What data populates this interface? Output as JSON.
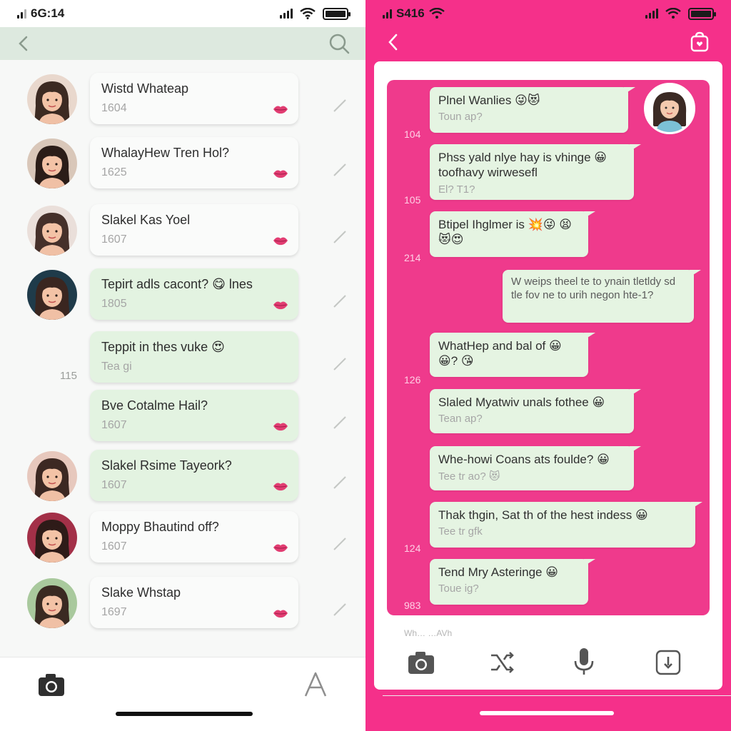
{
  "left_phone": {
    "status": {
      "time": "6G:14"
    },
    "chats": [
      {
        "name": "Wistd Whateap",
        "sub": "1604",
        "style": "white"
      },
      {
        "name": "WhalayHew Tren Hol?",
        "sub": "1625",
        "style": "white"
      },
      {
        "name": "Slakel Kas Yoel",
        "sub": "1607",
        "style": "white"
      },
      {
        "name": "Tepirt adls cacont? 😋 lnes",
        "sub": "1805",
        "style": "green"
      },
      {
        "name": "Teppit in thes vuke 😍",
        "sub": "Tea gi",
        "style": "green",
        "side_number": "115"
      },
      {
        "name": "Bve Cotalme Hail?",
        "sub": "1607",
        "style": "green"
      },
      {
        "name": "Slakel Rsime Tayeork?",
        "sub": "1607",
        "style": "green"
      },
      {
        "name": "Moppy Bhautind off?",
        "sub": "1607",
        "style": "white"
      },
      {
        "name": "Slake Whstap",
        "sub": "1697",
        "style": "white"
      }
    ]
  },
  "right_phone": {
    "status": {
      "time": "S416"
    },
    "messages": [
      {
        "text": "Plnel Wanlies 😜😻",
        "sub": "Toun ap?",
        "side": "104"
      },
      {
        "text": "Phss yald nlye hay is vhinge 😀 toofhavy wirwesefl",
        "sub": "El? T1?",
        "side": "105"
      },
      {
        "text": "Btipel Ihglmer is 💥😜 😫😻😍",
        "sub": "",
        "side": "214"
      },
      {
        "text": "W weips theel te to ynain tletldy sd tle fov ne to urih negon hte-1?",
        "sub": "",
        "side": ""
      },
      {
        "text": "WhatHep and bal of 😀 😀? 😘",
        "sub": "",
        "side": "126"
      },
      {
        "text": "Slaled Myatwiv unals fothee 😀",
        "sub": "Tean ap?",
        "side": ""
      },
      {
        "text": "Whe-howi Coans ats foulde? 😀",
        "sub": "Tee tr ao? 😻",
        "side": ""
      },
      {
        "text": "Thak thgin, Sat th of the hest indess 😀",
        "sub": "Tee tr gfk",
        "side": "124"
      },
      {
        "text": "Tend Mry Asteringe 😀",
        "sub": "Toue ig?",
        "side": "983"
      }
    ],
    "footer_caption": "Wh… …AVh"
  },
  "icons": {
    "back": "chevron-left-icon",
    "search": "search-icon",
    "camera": "camera-icon",
    "text": "font-a-icon",
    "bag": "bag-icon",
    "shuffle": "shuffle-icon",
    "mic": "microphone-icon",
    "attach": "attach-icon"
  },
  "colors": {
    "accent_pink": "#f5308a",
    "bubble_green": "#e5f4e2",
    "topbar_green": "#dde9df"
  }
}
